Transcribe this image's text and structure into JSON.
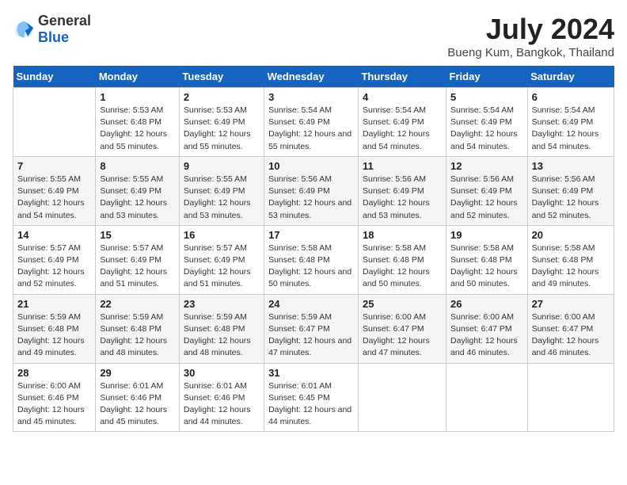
{
  "logo": {
    "general": "General",
    "blue": "Blue"
  },
  "title": "July 2024",
  "subtitle": "Bueng Kum, Bangkok, Thailand",
  "weekdays": [
    "Sunday",
    "Monday",
    "Tuesday",
    "Wednesday",
    "Thursday",
    "Friday",
    "Saturday"
  ],
  "weeks": [
    [
      {
        "day": "",
        "sunrise": "",
        "sunset": "",
        "daylight": ""
      },
      {
        "day": "1",
        "sunrise": "Sunrise: 5:53 AM",
        "sunset": "Sunset: 6:48 PM",
        "daylight": "Daylight: 12 hours and 55 minutes."
      },
      {
        "day": "2",
        "sunrise": "Sunrise: 5:53 AM",
        "sunset": "Sunset: 6:49 PM",
        "daylight": "Daylight: 12 hours and 55 minutes."
      },
      {
        "day": "3",
        "sunrise": "Sunrise: 5:54 AM",
        "sunset": "Sunset: 6:49 PM",
        "daylight": "Daylight: 12 hours and 55 minutes."
      },
      {
        "day": "4",
        "sunrise": "Sunrise: 5:54 AM",
        "sunset": "Sunset: 6:49 PM",
        "daylight": "Daylight: 12 hours and 54 minutes."
      },
      {
        "day": "5",
        "sunrise": "Sunrise: 5:54 AM",
        "sunset": "Sunset: 6:49 PM",
        "daylight": "Daylight: 12 hours and 54 minutes."
      },
      {
        "day": "6",
        "sunrise": "Sunrise: 5:54 AM",
        "sunset": "Sunset: 6:49 PM",
        "daylight": "Daylight: 12 hours and 54 minutes."
      }
    ],
    [
      {
        "day": "7",
        "sunrise": "Sunrise: 5:55 AM",
        "sunset": "Sunset: 6:49 PM",
        "daylight": "Daylight: 12 hours and 54 minutes."
      },
      {
        "day": "8",
        "sunrise": "Sunrise: 5:55 AM",
        "sunset": "Sunset: 6:49 PM",
        "daylight": "Daylight: 12 hours and 53 minutes."
      },
      {
        "day": "9",
        "sunrise": "Sunrise: 5:55 AM",
        "sunset": "Sunset: 6:49 PM",
        "daylight": "Daylight: 12 hours and 53 minutes."
      },
      {
        "day": "10",
        "sunrise": "Sunrise: 5:56 AM",
        "sunset": "Sunset: 6:49 PM",
        "daylight": "Daylight: 12 hours and 53 minutes."
      },
      {
        "day": "11",
        "sunrise": "Sunrise: 5:56 AM",
        "sunset": "Sunset: 6:49 PM",
        "daylight": "Daylight: 12 hours and 53 minutes."
      },
      {
        "day": "12",
        "sunrise": "Sunrise: 5:56 AM",
        "sunset": "Sunset: 6:49 PM",
        "daylight": "Daylight: 12 hours and 52 minutes."
      },
      {
        "day": "13",
        "sunrise": "Sunrise: 5:56 AM",
        "sunset": "Sunset: 6:49 PM",
        "daylight": "Daylight: 12 hours and 52 minutes."
      }
    ],
    [
      {
        "day": "14",
        "sunrise": "Sunrise: 5:57 AM",
        "sunset": "Sunset: 6:49 PM",
        "daylight": "Daylight: 12 hours and 52 minutes."
      },
      {
        "day": "15",
        "sunrise": "Sunrise: 5:57 AM",
        "sunset": "Sunset: 6:49 PM",
        "daylight": "Daylight: 12 hours and 51 minutes."
      },
      {
        "day": "16",
        "sunrise": "Sunrise: 5:57 AM",
        "sunset": "Sunset: 6:49 PM",
        "daylight": "Daylight: 12 hours and 51 minutes."
      },
      {
        "day": "17",
        "sunrise": "Sunrise: 5:58 AM",
        "sunset": "Sunset: 6:48 PM",
        "daylight": "Daylight: 12 hours and 50 minutes."
      },
      {
        "day": "18",
        "sunrise": "Sunrise: 5:58 AM",
        "sunset": "Sunset: 6:48 PM",
        "daylight": "Daylight: 12 hours and 50 minutes."
      },
      {
        "day": "19",
        "sunrise": "Sunrise: 5:58 AM",
        "sunset": "Sunset: 6:48 PM",
        "daylight": "Daylight: 12 hours and 50 minutes."
      },
      {
        "day": "20",
        "sunrise": "Sunrise: 5:58 AM",
        "sunset": "Sunset: 6:48 PM",
        "daylight": "Daylight: 12 hours and 49 minutes."
      }
    ],
    [
      {
        "day": "21",
        "sunrise": "Sunrise: 5:59 AM",
        "sunset": "Sunset: 6:48 PM",
        "daylight": "Daylight: 12 hours and 49 minutes."
      },
      {
        "day": "22",
        "sunrise": "Sunrise: 5:59 AM",
        "sunset": "Sunset: 6:48 PM",
        "daylight": "Daylight: 12 hours and 48 minutes."
      },
      {
        "day": "23",
        "sunrise": "Sunrise: 5:59 AM",
        "sunset": "Sunset: 6:48 PM",
        "daylight": "Daylight: 12 hours and 48 minutes."
      },
      {
        "day": "24",
        "sunrise": "Sunrise: 5:59 AM",
        "sunset": "Sunset: 6:47 PM",
        "daylight": "Daylight: 12 hours and 47 minutes."
      },
      {
        "day": "25",
        "sunrise": "Sunrise: 6:00 AM",
        "sunset": "Sunset: 6:47 PM",
        "daylight": "Daylight: 12 hours and 47 minutes."
      },
      {
        "day": "26",
        "sunrise": "Sunrise: 6:00 AM",
        "sunset": "Sunset: 6:47 PM",
        "daylight": "Daylight: 12 hours and 46 minutes."
      },
      {
        "day": "27",
        "sunrise": "Sunrise: 6:00 AM",
        "sunset": "Sunset: 6:47 PM",
        "daylight": "Daylight: 12 hours and 46 minutes."
      }
    ],
    [
      {
        "day": "28",
        "sunrise": "Sunrise: 6:00 AM",
        "sunset": "Sunset: 6:46 PM",
        "daylight": "Daylight: 12 hours and 45 minutes."
      },
      {
        "day": "29",
        "sunrise": "Sunrise: 6:01 AM",
        "sunset": "Sunset: 6:46 PM",
        "daylight": "Daylight: 12 hours and 45 minutes."
      },
      {
        "day": "30",
        "sunrise": "Sunrise: 6:01 AM",
        "sunset": "Sunset: 6:46 PM",
        "daylight": "Daylight: 12 hours and 44 minutes."
      },
      {
        "day": "31",
        "sunrise": "Sunrise: 6:01 AM",
        "sunset": "Sunset: 6:45 PM",
        "daylight": "Daylight: 12 hours and 44 minutes."
      },
      {
        "day": "",
        "sunrise": "",
        "sunset": "",
        "daylight": ""
      },
      {
        "day": "",
        "sunrise": "",
        "sunset": "",
        "daylight": ""
      },
      {
        "day": "",
        "sunrise": "",
        "sunset": "",
        "daylight": ""
      }
    ]
  ]
}
